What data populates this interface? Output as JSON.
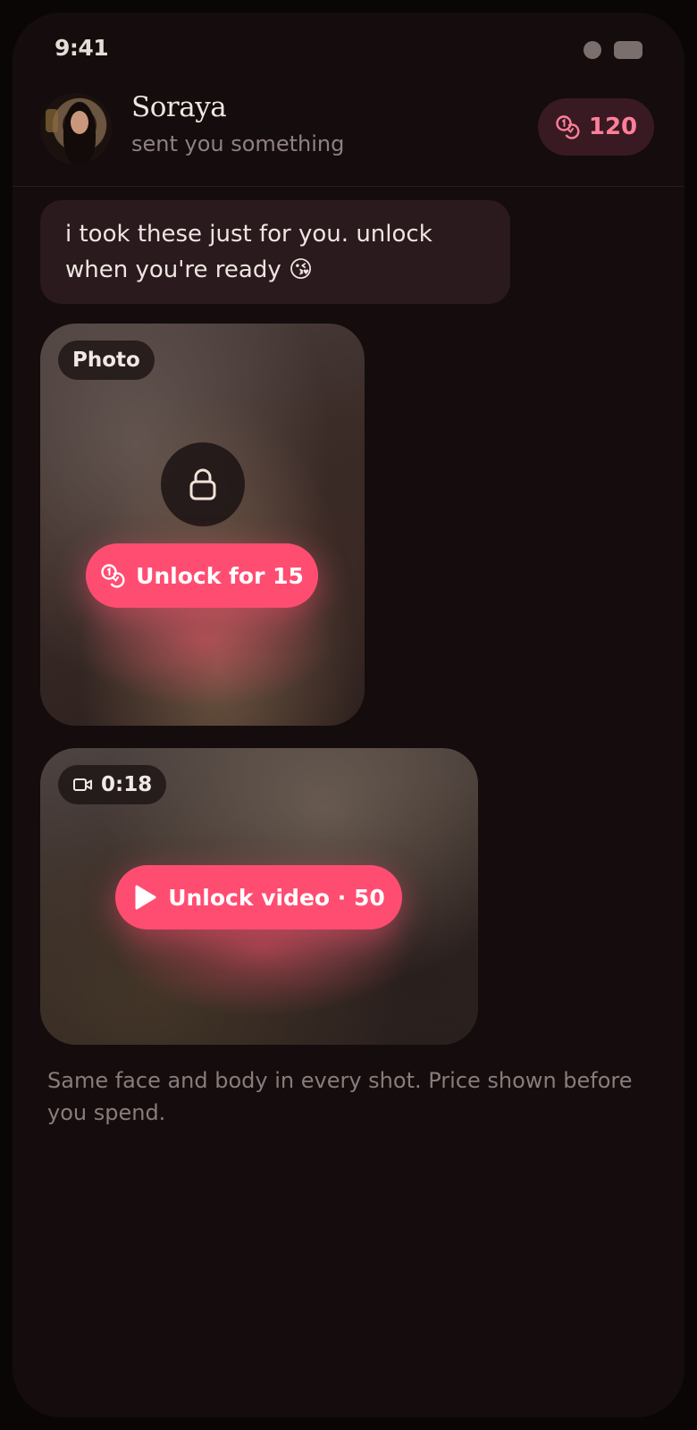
{
  "status_bar": {
    "time": "9:41"
  },
  "header": {
    "name": "Soraya",
    "subtitle": "sent you something",
    "coin_balance": "120"
  },
  "message": {
    "text": "i took these just for you. unlock when you're ready 😘"
  },
  "photo_card": {
    "tag": "Photo",
    "unlock_label": "Unlock for 15"
  },
  "video_card": {
    "duration": "0:18",
    "unlock_label": "Unlock video · 50"
  },
  "footnote": "Same face and body in every shot. Price shown before you spend.",
  "colors": {
    "accent": "#ff4d72",
    "coin_pill_bg": "#3a1a22",
    "coin_text": "#ff7f9a",
    "background": "#140c0d"
  },
  "icons": {
    "coin": "coins-icon",
    "lock": "lock-icon",
    "video": "video-camera-icon",
    "play": "play-icon"
  }
}
